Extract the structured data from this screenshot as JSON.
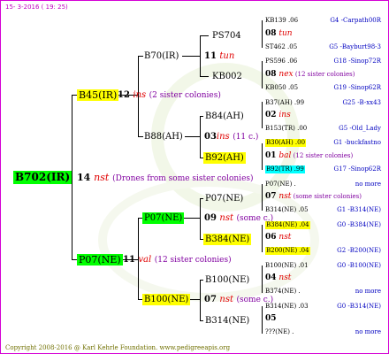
{
  "header": "15-  3-2016 ( 19: 25)",
  "footer": "Copyright 2008-2016 @ Karl Kehrle Foundation.   www.pedigreeapis.org",
  "root": {
    "name": "B702(IR)",
    "num": "14",
    "mark": "nst",
    "note": "(Drones from some sister colonies)"
  },
  "sire": {
    "name": "B45(IR)",
    "num": "12",
    "mark": "ins",
    "note": "(2 sister colonies)"
  },
  "dam": {
    "name": "P07(NE)",
    "num": "11",
    "mark": "val",
    "note": "(12 sister colonies)"
  },
  "b70": {
    "name": "B70(IR)",
    "num": "11",
    "mark": "tun"
  },
  "b88": {
    "name": "B88(AH)",
    "num": "03",
    "mark": "ins",
    "note": "(11 c.)"
  },
  "p07b": {
    "name": "P07(NE)",
    "num": "09",
    "mark": "nst",
    "note": "(some c.)"
  },
  "b100": {
    "name": "B100(NE)",
    "num": "07",
    "mark": "nst",
    "note": "(some c.)"
  },
  "g3": {
    "ps704": "PS704",
    "kb002": "KB002",
    "b84": "B84(AH)",
    "b92": "B92(AH)",
    "p07c": "P07(NE)",
    "b384": "B384(NE)",
    "b100c": "B100(NE)",
    "b314": "B314(NE)"
  },
  "right": [
    {
      "a": "KB139 .06",
      "b": "G4 -Carpath00R"
    },
    {
      "n": "08",
      "m": "tun"
    },
    {
      "a": "ST462 .05",
      "b": "G5 -Bayburt98-3"
    },
    {
      "a": "PS596 .06",
      "b": "G18 -Sinop72R"
    },
    {
      "n": "08",
      "m": "nex",
      "s": "(12 sister colonies)"
    },
    {
      "a": "KB050 .05",
      "b": "G19 -Sinop62R"
    },
    {
      "a": "B37(AH) .99",
      "b": "G25 -B-xx43"
    },
    {
      "n": "02",
      "m": "ins"
    },
    {
      "a": "B153(TR) .00",
      "b": "G5 -Old_Lady"
    },
    {
      "a": "B30(AH) .00",
      "b": "G1 -buckfastno"
    },
    {
      "n": "01",
      "m": "bal",
      "s": "(12 sister colonies)"
    },
    {
      "a": "B92(TR) .99",
      "b": "G17 -Sinop62R"
    },
    {
      "a": "P07(NE) .",
      "b": "no more"
    },
    {
      "n": "07",
      "m": "nst",
      "s": "(some sister colonies)"
    },
    {
      "a": "B314(NE) .05",
      "b": "G1 -B314(NE)"
    },
    {
      "a": "B384(NE) .04",
      "b": "G0 -B384(NE)"
    },
    {
      "n": "06",
      "m": "nst"
    },
    {
      "a": "B200(NE) .04",
      "b": "G2 -B200(NE)"
    },
    {
      "a": "B100(NE) .01",
      "b": "G0 -B100(NE)"
    },
    {
      "n": "04",
      "m": "nst"
    },
    {
      "a": "B374(NE) .",
      "b": "no more"
    },
    {
      "a": "B314(NE) .03",
      "b": "G0 -B314(NE)"
    },
    {
      "n": "05"
    },
    {
      "a": "???(NE) .",
      "b": "no more"
    }
  ]
}
